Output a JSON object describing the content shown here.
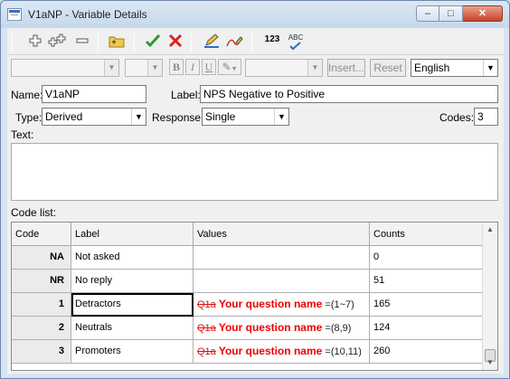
{
  "window": {
    "title": "V1aNP - Variable Details",
    "buttons": {
      "minimize": "–",
      "maximize": "□",
      "close": "✕"
    }
  },
  "toolbar": {
    "icons": [
      "plus-icon",
      "plus-plus-icon",
      "minus-icon",
      "folder-up-icon",
      "check-icon",
      "cross-icon",
      "edit-icon",
      "chart-edit-icon",
      "numbering-icon",
      "spellcheck-icon"
    ],
    "numbering_text": "123",
    "spell_text": "ABC"
  },
  "format_bar": {
    "bold": "B",
    "italic": "I",
    "underline": "U",
    "insert_label": "Insert...",
    "reset_label": "Reset",
    "language": "English"
  },
  "form": {
    "name_label": "Name:",
    "name_value": "V1aNP",
    "label_label": "Label:",
    "label_value": "NPS Negative to Positive",
    "type_label": "Type:",
    "type_value": "Derived",
    "response_label": "Response:",
    "response_value": "Single",
    "codes_label": "Codes:",
    "codes_value": "3",
    "text_label": "Text:",
    "codelist_label": "Code list:"
  },
  "table": {
    "headers": {
      "code": "Code",
      "label": "Label",
      "values": "Values",
      "counts": "Counts"
    },
    "rows": [
      {
        "code": "NA",
        "label": "Not asked",
        "strike": "",
        "qname": "",
        "tail": "",
        "count": "0"
      },
      {
        "code": "NR",
        "label": "No reply",
        "strike": "",
        "qname": "",
        "tail": "",
        "count": "51"
      },
      {
        "code": "1",
        "label": "Detractors",
        "strike": "Q1a",
        "qname": "Your question name",
        "tail": "=(1~7)",
        "count": "165"
      },
      {
        "code": "2",
        "label": "Neutrals",
        "strike": "Q1a",
        "qname": "Your question name",
        "tail": "=(8,9)",
        "count": "124"
      },
      {
        "code": "3",
        "label": "Promoters",
        "strike": "Q1a",
        "qname": "Your question name",
        "tail": "=(10,11)",
        "count": "260"
      }
    ]
  }
}
